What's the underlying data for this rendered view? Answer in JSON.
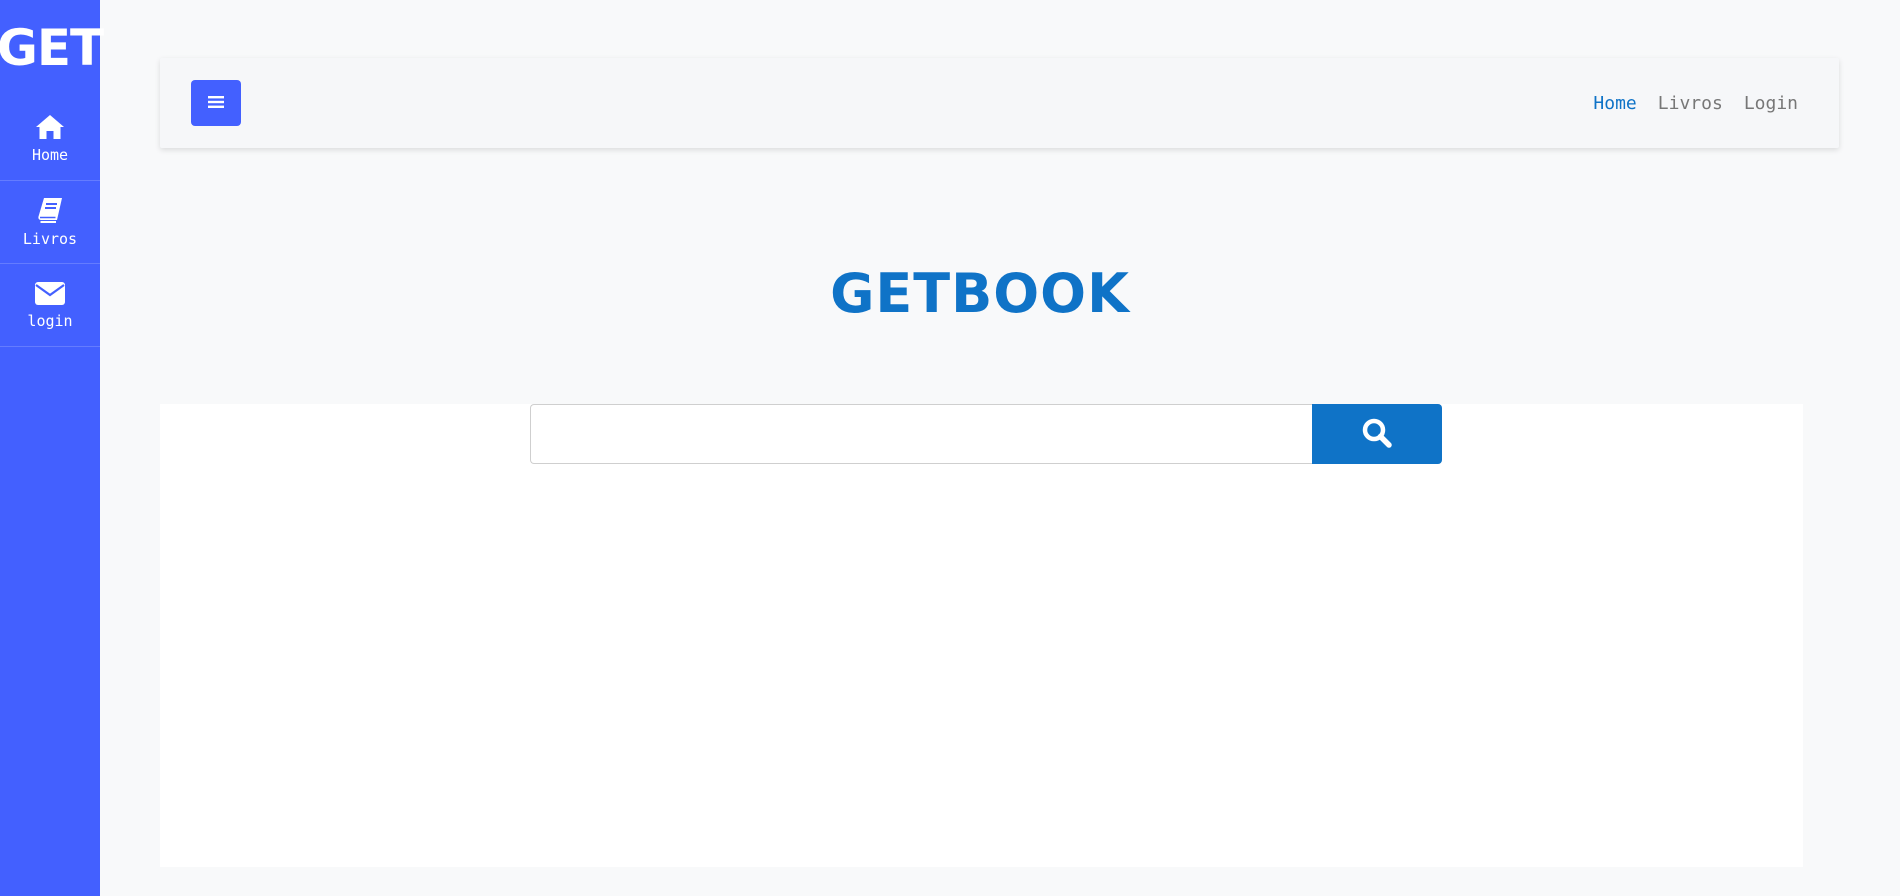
{
  "sidebar": {
    "brand": "GET",
    "items": [
      {
        "label": "Home",
        "icon": "home-icon"
      },
      {
        "label": "Livros",
        "icon": "book-icon"
      },
      {
        "label": "login",
        "icon": "envelope-icon"
      }
    ]
  },
  "navbar": {
    "toggle_icon": "hamburger-menu-icon",
    "links": [
      {
        "label": "Home",
        "active": true
      },
      {
        "label": "Livros",
        "active": false
      },
      {
        "label": "Login",
        "active": false
      }
    ]
  },
  "main": {
    "title": "GETBOOK",
    "search": {
      "value": "",
      "placeholder": "",
      "button_icon": "search-icon"
    }
  },
  "colors": {
    "sidebar": "#4360ff",
    "accent": "#0f73c7",
    "background": "#f8f9fa",
    "nav_link": "#777777"
  }
}
